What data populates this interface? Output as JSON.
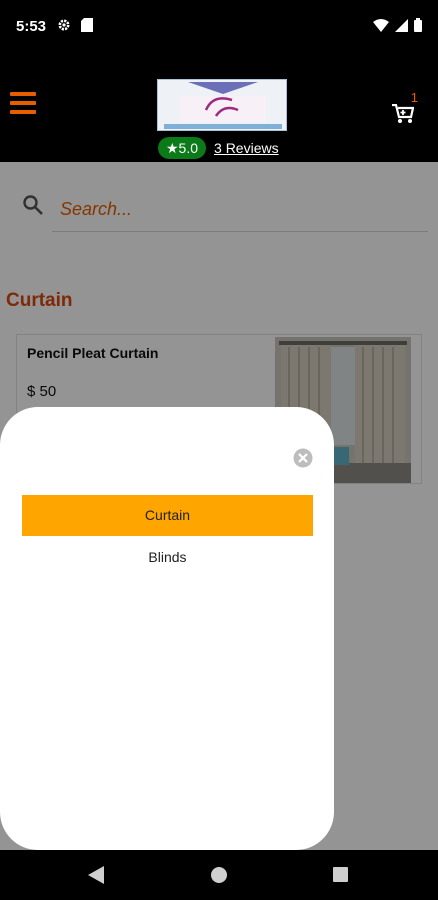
{
  "status_bar": {
    "time": "5:53",
    "icons": [
      "gear-icon",
      "sd-card-icon",
      "wifi-icon",
      "signal-icon",
      "battery-icon"
    ]
  },
  "header": {
    "rating": "★5.0",
    "reviews_link": "3 Reviews",
    "cart_count": "1",
    "accent_color": "#e65e00"
  },
  "search": {
    "placeholder": "Search..."
  },
  "catalog": {
    "section_title": "Curtain",
    "products": [
      {
        "name": "Pencil Pleat Curtain",
        "price": "$ 50"
      }
    ]
  },
  "category_sheet": {
    "options": [
      {
        "label": "Curtain",
        "selected": true
      },
      {
        "label": "Blinds",
        "selected": false
      }
    ],
    "selected_color": "#ffa500"
  },
  "nav_bar": {
    "buttons": [
      "back-icon",
      "home-icon",
      "recents-icon"
    ]
  }
}
